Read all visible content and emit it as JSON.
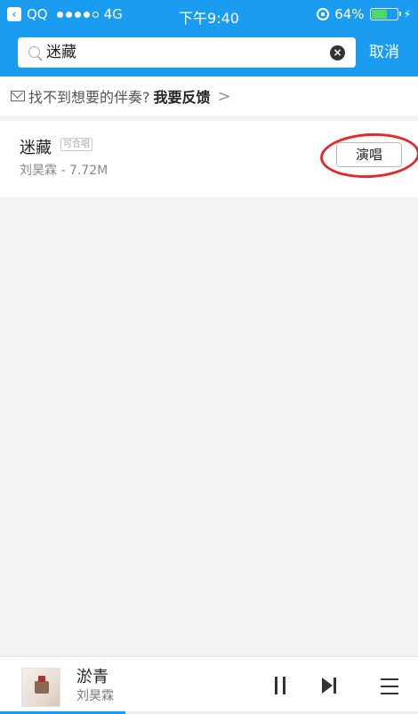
{
  "status_bar": {
    "back_app": "QQ",
    "network": "4G",
    "time": "下午9:40",
    "battery": "64%",
    "battery_level": 0.64
  },
  "search": {
    "query": "迷藏",
    "cancel_label": "取消"
  },
  "feedback": {
    "prompt": "找不到想要的伴奏?",
    "action": "我要反馈",
    "chevron": ">"
  },
  "results": [
    {
      "title": "迷藏",
      "badge": "可合唱",
      "subtitle": "刘昊霖 - 7.72M",
      "button_label": "演唱"
    }
  ],
  "player": {
    "title": "淤青",
    "artist": "刘昊霖",
    "progress": 0.3
  },
  "colors": {
    "brand": "#1a9df0",
    "annotation": "#e52828"
  },
  "icons": [
    "back-icon",
    "search-icon",
    "clear-icon",
    "mail-icon",
    "pause-icon",
    "next-icon",
    "playlist-icon"
  ]
}
